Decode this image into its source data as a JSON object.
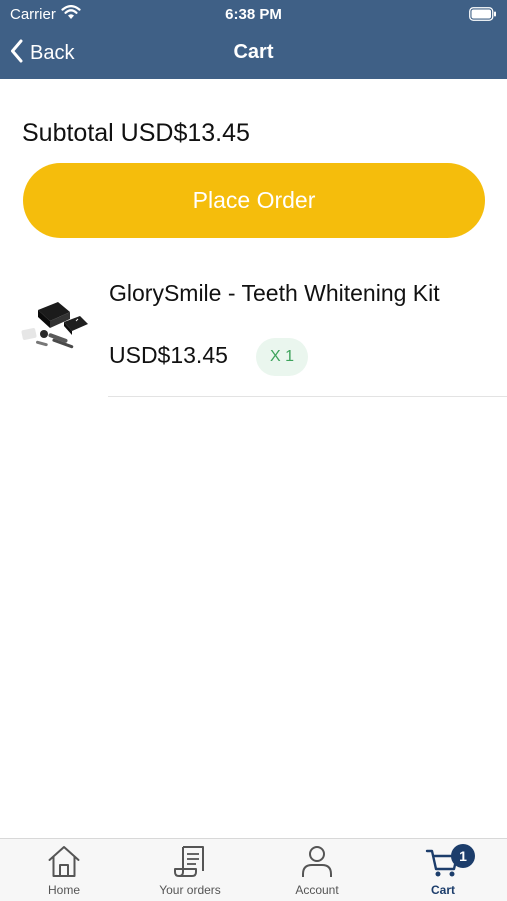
{
  "status_bar": {
    "carrier": "Carrier",
    "time": "6:38 PM"
  },
  "nav": {
    "back_label": "Back",
    "title": "Cart"
  },
  "cart": {
    "subtotal": "Subtotal USD$13.45",
    "place_order_label": "Place Order",
    "items": [
      {
        "name": "GlorySmile - Teeth Whitening Kit",
        "price": "USD$13.45",
        "quantity": "X 1"
      }
    ]
  },
  "tabbar": {
    "tabs": [
      {
        "label": "Home",
        "icon": "home-icon"
      },
      {
        "label": "Your orders",
        "icon": "receipt-icon"
      },
      {
        "label": "Account",
        "icon": "person-icon"
      },
      {
        "label": "Cart",
        "icon": "cart-icon",
        "badge": "1"
      }
    ],
    "active_tab": "Cart"
  },
  "colors": {
    "header": "#3f6086",
    "place_order": "#f5bd0c",
    "quantity_text": "#3ea35c",
    "active_tab": "#1c3d6b"
  }
}
